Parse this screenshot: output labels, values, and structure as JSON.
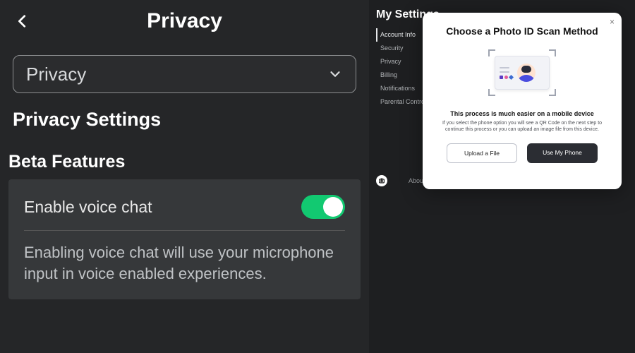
{
  "left": {
    "back_icon": "chevron-left",
    "title": "Privacy",
    "dropdown": {
      "selected": "Privacy"
    },
    "section_title": "Privacy Settings",
    "subsection": "Beta Features",
    "voice_chat": {
      "label": "Enable voice chat",
      "enabled": true,
      "description": "Enabling voice chat will use your microphone input in voice enabled experiences."
    }
  },
  "right": {
    "page_title": "My Settings",
    "nav": [
      {
        "label": "Account Info",
        "active": true
      },
      {
        "label": "Security",
        "active": false
      },
      {
        "label": "Privacy",
        "active": false
      },
      {
        "label": "Billing",
        "active": false
      },
      {
        "label": "Notifications",
        "active": false
      },
      {
        "label": "Parental Controls",
        "active": false
      }
    ],
    "footer": {
      "about": "About Us"
    }
  },
  "modal": {
    "title": "Choose a Photo ID Scan Method",
    "subtitle": "This process is much easier on a mobile device",
    "description": "If you select the phone option you will see a QR Code on the next step to continue this process or you can upload an image file from this device.",
    "upload_label": "Upload a File",
    "phone_label": "Use My Phone",
    "close_glyph": "×"
  }
}
